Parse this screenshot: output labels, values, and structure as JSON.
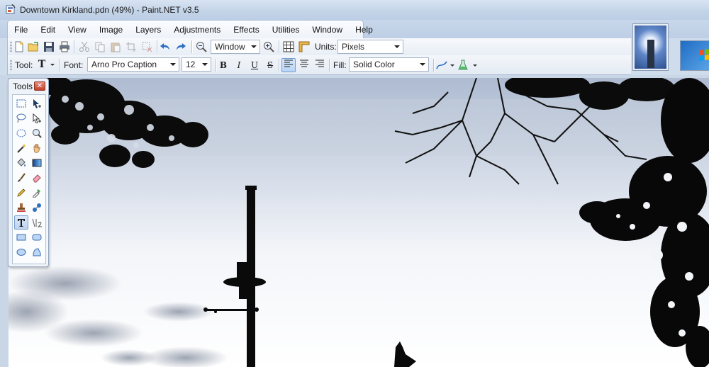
{
  "window": {
    "title": "Downtown Kirkland.pdn (49%) - Paint.NET v3.5"
  },
  "menu": [
    "File",
    "Edit",
    "View",
    "Image",
    "Layers",
    "Adjustments",
    "Effects",
    "Utilities",
    "Window",
    "Help"
  ],
  "toolbar": {
    "zoom_value": "Window",
    "units_label": "Units:",
    "units_value": "Pixels"
  },
  "textbar": {
    "tool_label": "Tool:",
    "font_label": "Font:",
    "font_value": "Arno Pro Caption",
    "size_value": "12",
    "bold": "B",
    "italic": "I",
    "underline": "U",
    "strike": "S",
    "fill_label": "Fill:",
    "fill_value": "Solid Color",
    "alignment_selected": "left"
  },
  "tools_window": {
    "title": "Tools",
    "selected_tool": "text-tool"
  },
  "colors": {
    "accent": "#6e9ad2",
    "close_button": "#c4402c",
    "sky_top": "#b8c6db",
    "sky_bottom": "#ffffff",
    "silhouette": "#0a0a0a"
  }
}
